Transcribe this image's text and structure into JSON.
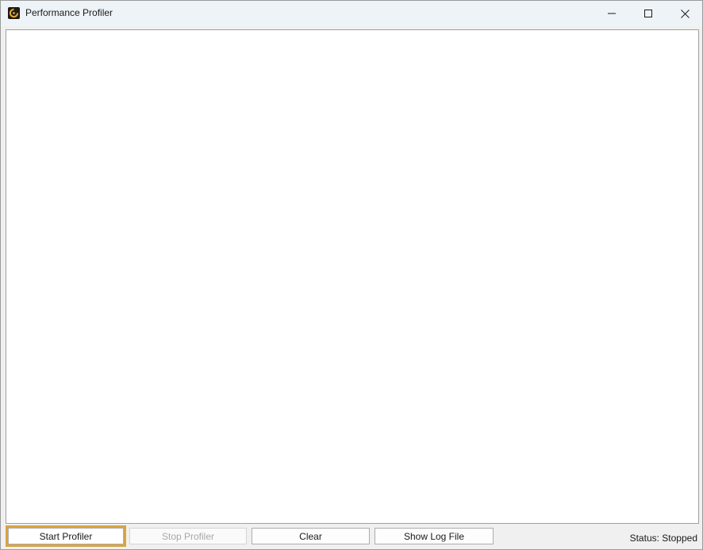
{
  "window": {
    "title": "Performance Profiler"
  },
  "icons": {
    "app": "profiler-app-icon",
    "minimize": "minimize-icon",
    "maximize": "maximize-icon",
    "close": "close-icon"
  },
  "colors": {
    "focus_outline": "#d9a441",
    "titlebar_bg": "#eef3f8",
    "app_icon_bg": "#1f1a12",
    "app_icon_accent": "#e0a53a"
  },
  "toolbar": {
    "start_label": "Start Profiler",
    "stop_label": "Stop Profiler",
    "clear_label": "Clear",
    "log_label": "Show Log File"
  },
  "status": {
    "text": "Status: Stopped"
  }
}
